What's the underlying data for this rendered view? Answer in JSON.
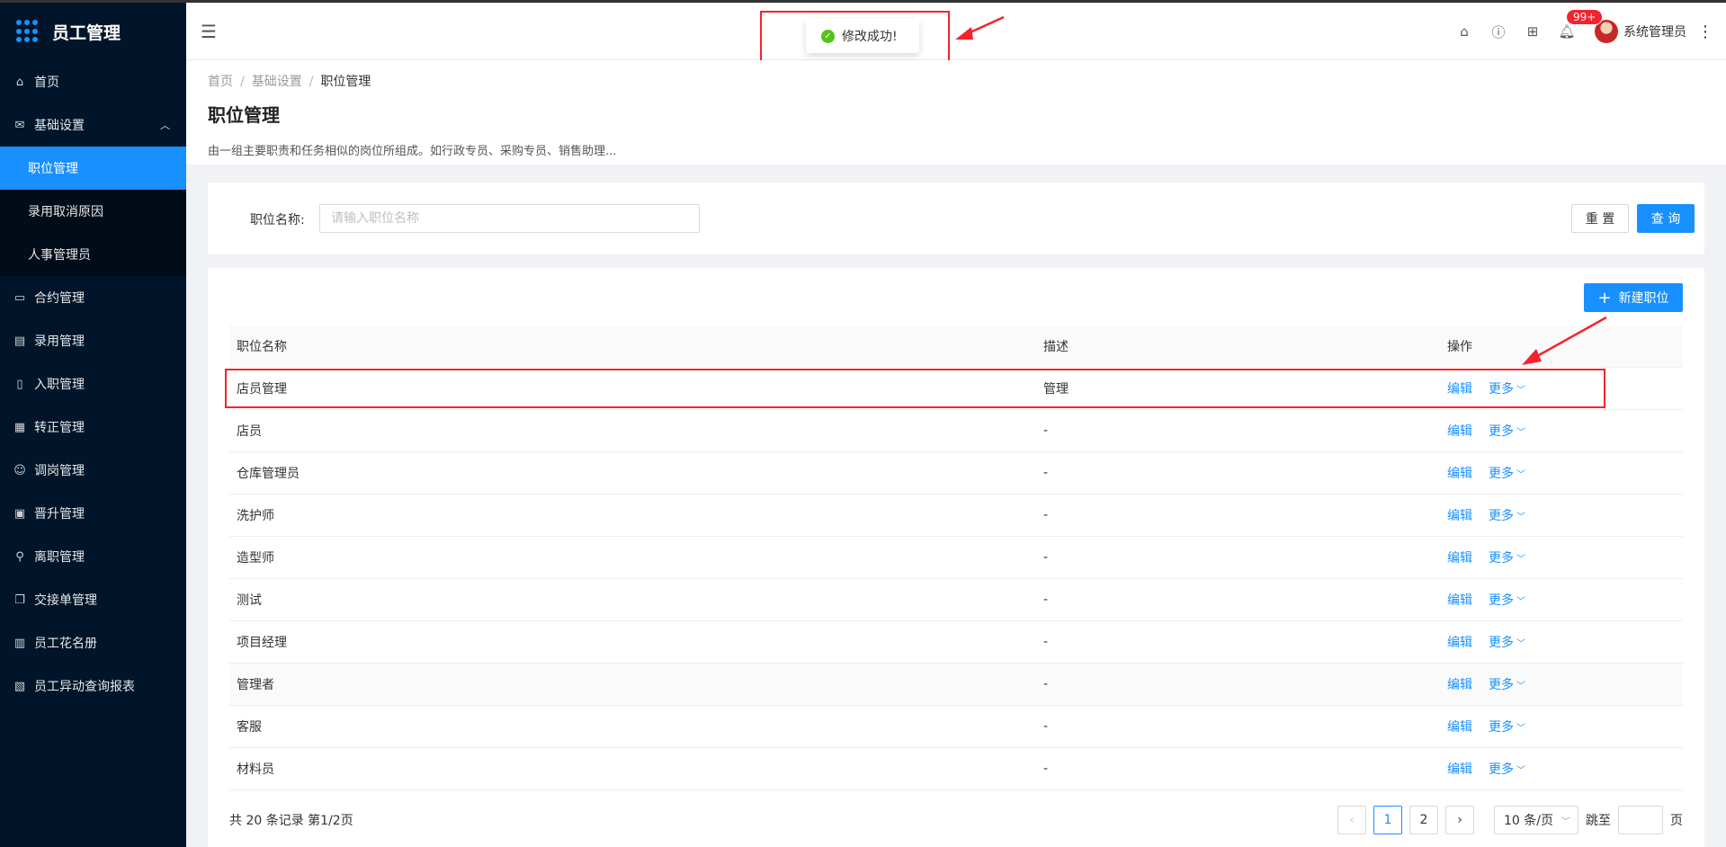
{
  "app": {
    "title": "员工管理"
  },
  "sidebar": {
    "items": [
      {
        "label": "首页",
        "icon": "home-icon"
      },
      {
        "label": "基础设置",
        "icon": "mail-icon",
        "expanded": true
      },
      {
        "label": "合约管理",
        "icon": "calendar-icon"
      },
      {
        "label": "录用管理",
        "icon": "contract-icon"
      },
      {
        "label": "入职管理",
        "icon": "book-icon"
      },
      {
        "label": "转正管理",
        "icon": "grid-icon"
      },
      {
        "label": "调岗管理",
        "icon": "user-icon"
      },
      {
        "label": "晋升管理",
        "icon": "file-icon"
      },
      {
        "label": "离职管理",
        "icon": "leave-icon"
      },
      {
        "label": "交接单管理",
        "icon": "copy-icon"
      },
      {
        "label": "员工花名册",
        "icon": "roster-icon"
      },
      {
        "label": "员工异动查询报表",
        "icon": "report-icon"
      }
    ],
    "submenu": [
      {
        "label": "职位管理",
        "active": true
      },
      {
        "label": "录用取消原因"
      },
      {
        "label": "人事管理员"
      }
    ]
  },
  "header": {
    "notification_count": "99+",
    "username": "系统管理员"
  },
  "toast": {
    "message": "修改成功!"
  },
  "breadcrumb": {
    "home": "首页",
    "parent": "基础设置",
    "current": "职位管理"
  },
  "page": {
    "title": "职位管理",
    "description": "由一组主要职责和任务相似的岗位所组成。如行政专员、采购专员、销售助理..."
  },
  "search": {
    "label": "职位名称:",
    "placeholder": "请输入职位名称",
    "reset_label": "重 置",
    "query_label": "查 询"
  },
  "table": {
    "new_label": "新建职位",
    "columns": {
      "name": "职位名称",
      "desc": "描述",
      "action": "操作"
    },
    "edit_label": "编辑",
    "more_label": "更多",
    "rows": [
      {
        "name": "店员管理",
        "desc": "管理"
      },
      {
        "name": "店员",
        "desc": "-"
      },
      {
        "name": "仓库管理员",
        "desc": "-"
      },
      {
        "name": "洗护师",
        "desc": "-"
      },
      {
        "name": "造型师",
        "desc": "-"
      },
      {
        "name": "测试",
        "desc": "-"
      },
      {
        "name": "项目经理",
        "desc": "-"
      },
      {
        "name": "管理者",
        "desc": "-"
      },
      {
        "name": "客服",
        "desc": "-"
      },
      {
        "name": "材料员",
        "desc": "-"
      }
    ]
  },
  "pagination": {
    "total_text": "共 20 条记录 第1/2页",
    "pages": [
      "1",
      "2"
    ],
    "current_page": "1",
    "page_size": "10 条/页",
    "jump_label": "跳至",
    "page_suffix": "页"
  },
  "colors": {
    "primary": "#1890ff",
    "sidebar_bg": "#001529",
    "annotation": "#f5222d",
    "success": "#52c41a"
  }
}
